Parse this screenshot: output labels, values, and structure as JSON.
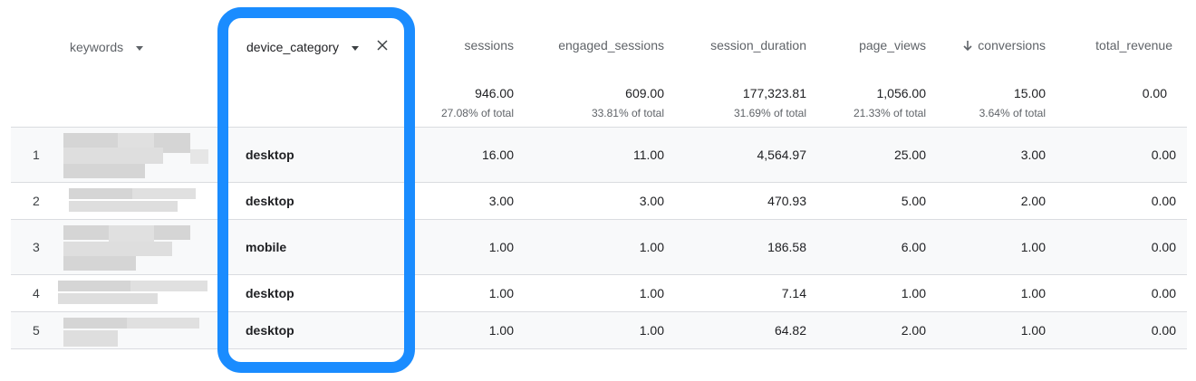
{
  "header": {
    "keywords": "keywords",
    "device_category": "device_category",
    "sessions": "sessions",
    "engaged_sessions": "engaged_sessions",
    "session_duration": "session_duration",
    "page_views": "page_views",
    "conversions": "conversions",
    "total_revenue": "total_revenue"
  },
  "totals": {
    "sessions": {
      "value": "946.00",
      "pct": "27.08% of total"
    },
    "engaged_sessions": {
      "value": "609.00",
      "pct": "33.81% of total"
    },
    "session_duration": {
      "value": "177,323.81",
      "pct": "31.69% of total"
    },
    "page_views": {
      "value": "1,056.00",
      "pct": "21.33% of total"
    },
    "conversions": {
      "value": "15.00",
      "pct": "3.64% of total"
    },
    "total_revenue": {
      "value": "0.00"
    }
  },
  "rows": [
    {
      "idx": "1",
      "device": "desktop",
      "sessions": "16.00",
      "engaged": "11.00",
      "duration": "4,564.97",
      "views": "25.00",
      "conversions": "3.00",
      "revenue": "0.00"
    },
    {
      "idx": "2",
      "device": "desktop",
      "sessions": "3.00",
      "engaged": "3.00",
      "duration": "470.93",
      "views": "5.00",
      "conversions": "2.00",
      "revenue": "0.00"
    },
    {
      "idx": "3",
      "device": "mobile",
      "sessions": "1.00",
      "engaged": "1.00",
      "duration": "186.58",
      "views": "6.00",
      "conversions": "1.00",
      "revenue": "0.00"
    },
    {
      "idx": "4",
      "device": "desktop",
      "sessions": "1.00",
      "engaged": "1.00",
      "duration": "7.14",
      "views": "1.00",
      "conversions": "1.00",
      "revenue": "0.00"
    },
    {
      "idx": "5",
      "device": "desktop",
      "sessions": "1.00",
      "engaged": "1.00",
      "duration": "64.82",
      "views": "2.00",
      "conversions": "1.00",
      "revenue": "0.00"
    }
  ],
  "colors": {
    "highlight": "#1a8cff",
    "border": "#dadce0",
    "alt_row": "#f8f9fa"
  },
  "icons": {
    "sort": "arrow-down-icon",
    "dropdown": "caret-down-icon",
    "remove": "close-icon"
  }
}
